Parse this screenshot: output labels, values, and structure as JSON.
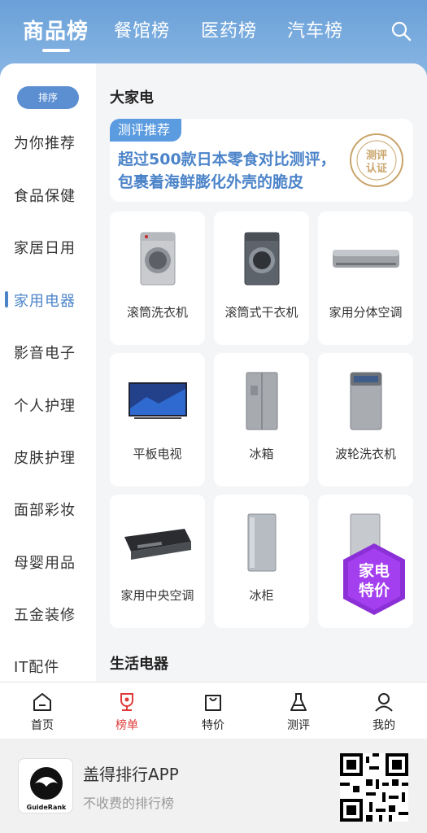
{
  "header": {
    "tabs": [
      {
        "label": "商品榜",
        "active": true
      },
      {
        "label": "餐馆榜",
        "active": false
      },
      {
        "label": "医药榜",
        "active": false
      },
      {
        "label": "汽车榜",
        "active": false
      }
    ],
    "search_icon": "search-icon"
  },
  "sidebar": {
    "sort_label": "排序",
    "items": [
      {
        "label": "为你推荐"
      },
      {
        "label": "食品保健"
      },
      {
        "label": "家居日用"
      },
      {
        "label": "家用电器",
        "active": true
      },
      {
        "label": "影音电子"
      },
      {
        "label": "个人护理"
      },
      {
        "label": "皮肤护理"
      },
      {
        "label": "面部彩妆"
      },
      {
        "label": "母婴用品"
      },
      {
        "label": "五金装修"
      },
      {
        "label": "IT配件"
      }
    ]
  },
  "main": {
    "section1_title": "大家电",
    "banner": {
      "tag": "测评推荐",
      "text": "超过500款日本零食对比测评，包裹着海鲜膨化外壳的脆皮",
      "seal_line1": "测评",
      "seal_line2": "认证",
      "seal_ring": "GUIDERANK"
    },
    "products": [
      {
        "label": "滚筒洗衣机",
        "icon": "front-load-washer-icon"
      },
      {
        "label": "滚筒式干衣机",
        "icon": "dryer-icon"
      },
      {
        "label": "家用分体空调",
        "icon": "split-ac-icon"
      },
      {
        "label": "平板电视",
        "icon": "tv-icon"
      },
      {
        "label": "冰箱",
        "icon": "fridge-icon"
      },
      {
        "label": "波轮洗衣机",
        "icon": "top-load-washer-icon"
      },
      {
        "label": "家用中央空调",
        "icon": "central-ac-icon"
      },
      {
        "label": "冰柜",
        "icon": "freezer-icon"
      },
      {
        "label": "",
        "icon": "small-fridge-icon"
      }
    ],
    "promo_badge": {
      "line1": "家电",
      "line2": "特价"
    },
    "section2_title": "生活电器"
  },
  "bottom_nav": [
    {
      "label": "首页",
      "icon": "home-icon"
    },
    {
      "label": "榜单",
      "icon": "trophy-icon",
      "active": true
    },
    {
      "label": "特价",
      "icon": "bag-icon"
    },
    {
      "label": "测评",
      "icon": "flask-icon"
    },
    {
      "label": "我的",
      "icon": "user-icon"
    }
  ],
  "footer": {
    "app_name": "盖得排行APP",
    "slogan": "不收费的排行榜",
    "logo_text": "GuideRank"
  },
  "colors": {
    "header_top": "#6aa0d8",
    "accent_blue": "#4c84c9",
    "active_red": "#e03b3b",
    "promo_purple": "#8a2be2"
  }
}
